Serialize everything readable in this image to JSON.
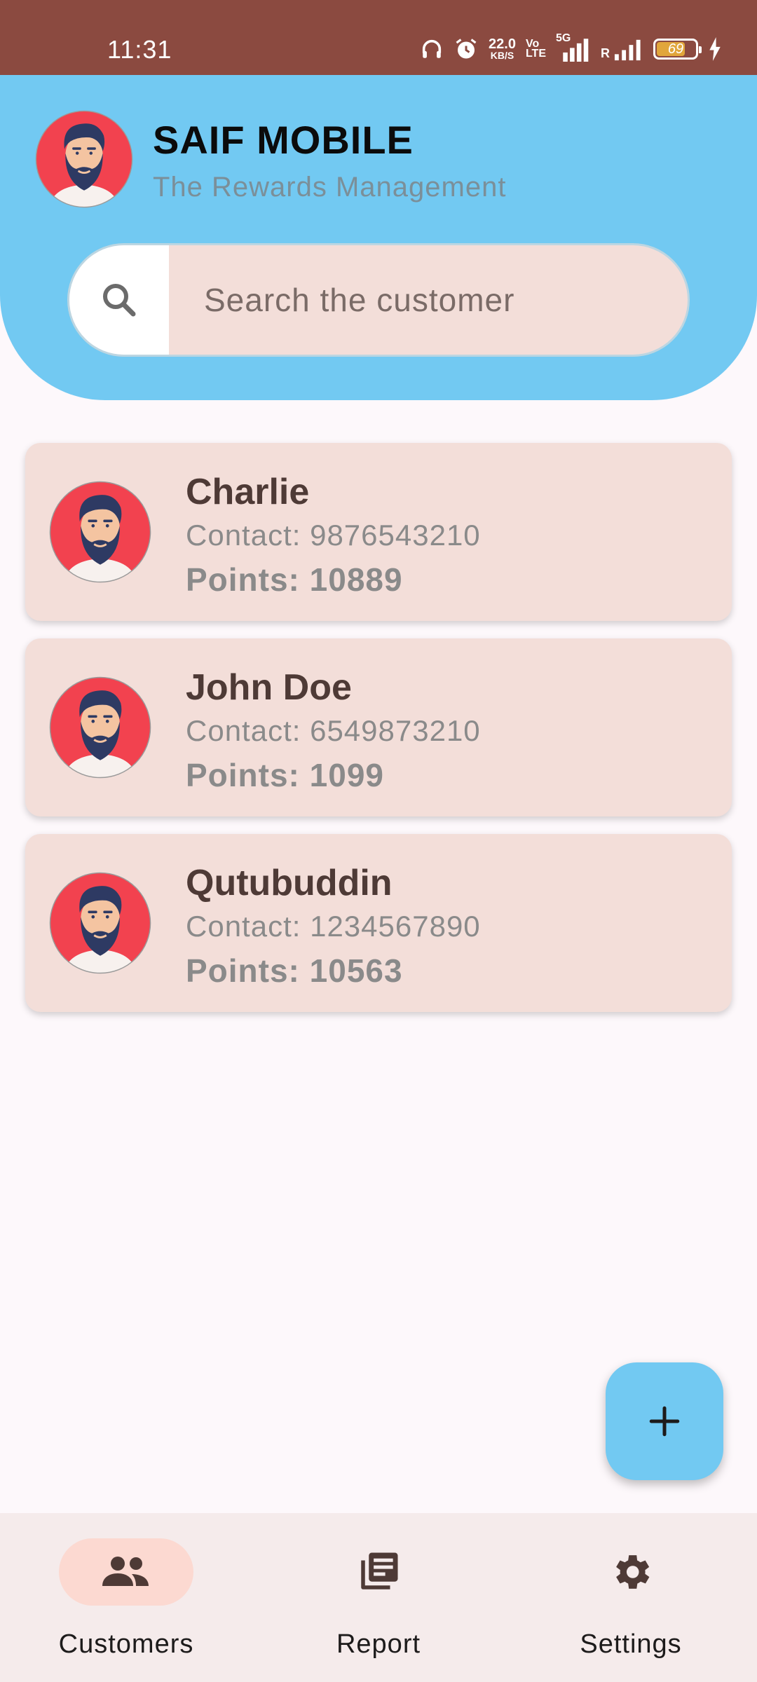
{
  "status_bar": {
    "time": "11:31",
    "net_speed_value": "22.0",
    "net_speed_unit": "KB/S",
    "volte_top": "Vo",
    "volte_bottom": "LTE",
    "network": "5G",
    "roaming": "R",
    "battery": "69",
    "icons": [
      "headphones-icon",
      "alarm-icon",
      "signal-icon",
      "battery-icon",
      "charging-icon"
    ]
  },
  "header": {
    "title": "SAIF MOBILE",
    "subtitle": "The Rewards Management",
    "background_color": "#72c9f2"
  },
  "search": {
    "placeholder": "Search the customer",
    "icon": "search-icon"
  },
  "customers": [
    {
      "name": "Charlie",
      "contact": "Contact: 9876543210",
      "points": "Points: 10889"
    },
    {
      "name": "John Doe",
      "contact": "Contact: 6549873210",
      "points": "Points: 1099"
    },
    {
      "name": "Qutubuddin",
      "contact": "Contact: 1234567890",
      "points": "Points: 10563"
    }
  ],
  "fab": {
    "icon": "plus-icon"
  },
  "bottom_nav": {
    "items": [
      {
        "label": "Customers",
        "icon": "people-icon",
        "active": true
      },
      {
        "label": "Report",
        "icon": "report-icon",
        "active": false
      },
      {
        "label": "Settings",
        "icon": "gear-icon",
        "active": false
      }
    ]
  },
  "colors": {
    "status_bar": "#8b4a40",
    "accent": "#72c9f2",
    "card": "#f3ded9",
    "nav_active": "#fcd9d1"
  }
}
